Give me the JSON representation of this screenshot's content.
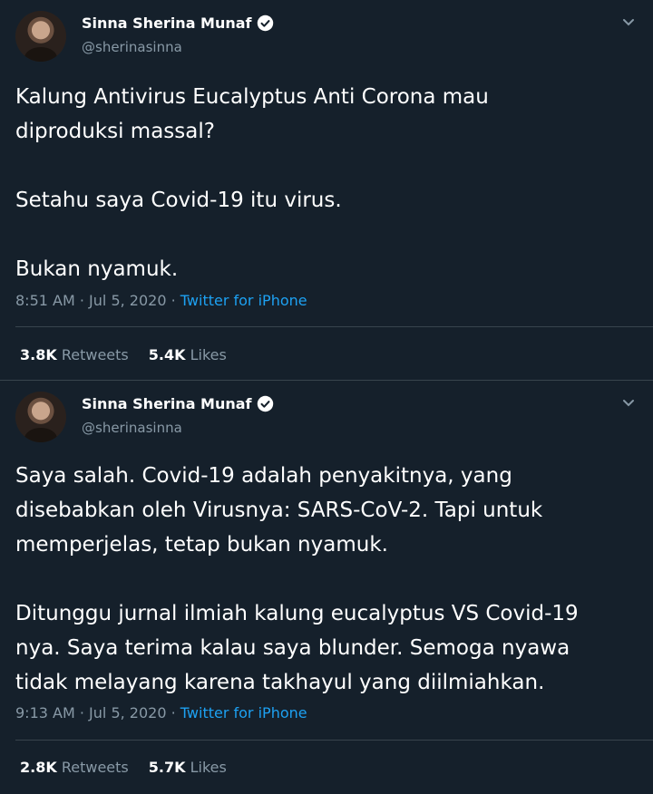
{
  "tweets": [
    {
      "name": "Sinna Sherina Munaf",
      "handle": "@sherinasinna",
      "text": "Kalung Antivirus Eucalyptus Anti Corona mau\ndiproduksi massal?\n\nSetahu saya Covid-19 itu virus.\n\nBukan nyamuk.",
      "time": "8:51 AM",
      "date": "Jul 5, 2020",
      "source": "Twitter for iPhone",
      "retweets": "3.8K",
      "retweets_label": "Retweets",
      "likes": "5.4K",
      "likes_label": "Likes"
    },
    {
      "name": "Sinna Sherina Munaf",
      "handle": "@sherinasinna",
      "text": "Saya salah. Covid-19 adalah penyakitnya, yang\ndisebabkan oleh Virusnya: SARS-CoV-2. Tapi untuk\nmemperjelas, tetap bukan nyamuk.\n\nDitunggu jurnal ilmiah kalung eucalyptus VS Covid-19\nnya. Saya terima kalau saya blunder. Semoga nyawa\ntidak melayang karena takhayul yang diilmiahkan.",
      "time": "9:13 AM",
      "date": "Jul 5, 2020",
      "source": "Twitter for iPhone",
      "retweets": "2.8K",
      "retweets_label": "Retweets",
      "likes": "5.7K",
      "likes_label": "Likes"
    }
  ],
  "separator": "·",
  "icons": [
    "verified-badge-icon",
    "chevron-down-icon"
  ],
  "colors": {
    "background": "#15202b",
    "text": "#ffffff",
    "muted": "#8899a6",
    "link": "#1da1f2",
    "divider": "#38444d"
  }
}
